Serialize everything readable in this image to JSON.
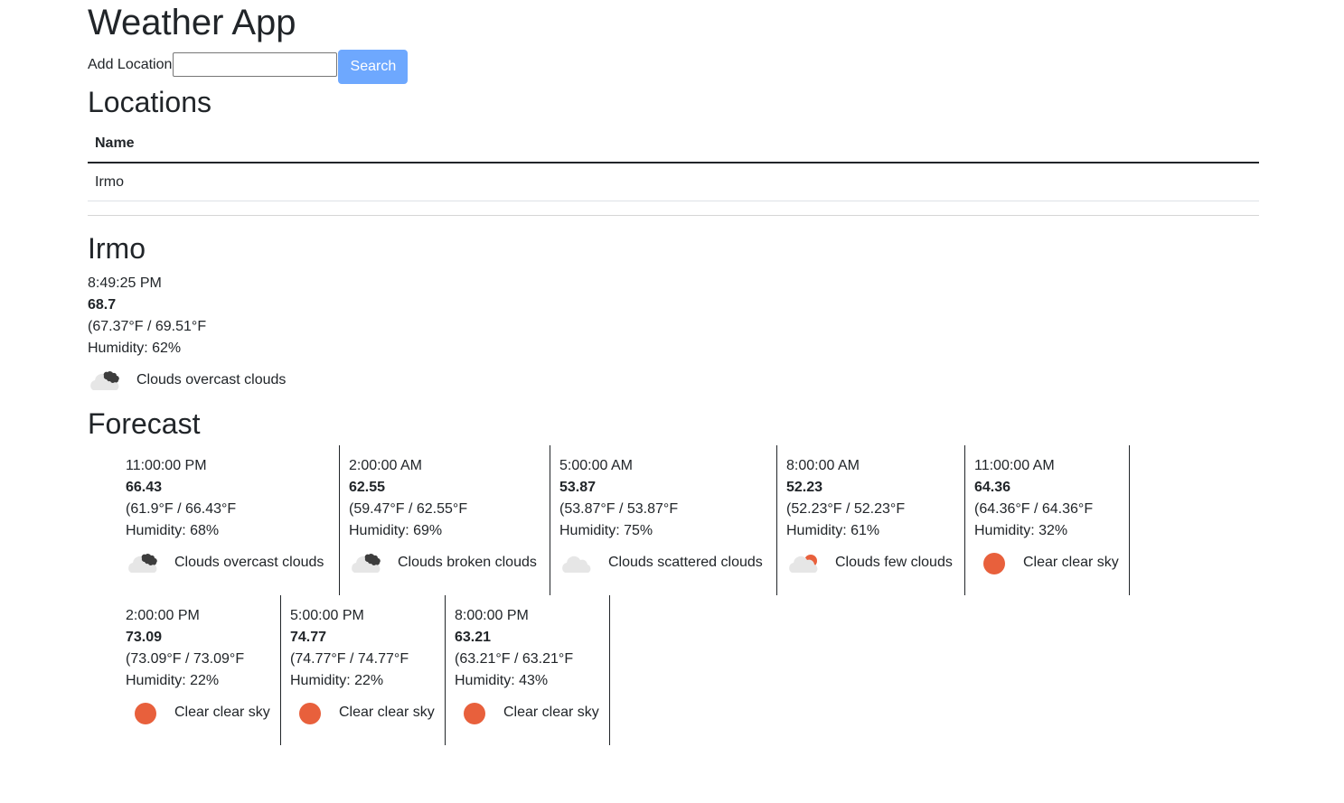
{
  "app": {
    "title": "Weather App"
  },
  "add_location": {
    "label": "Add Location",
    "input_value": "",
    "input_placeholder": "",
    "search_label": "Search"
  },
  "locations": {
    "title": "Locations",
    "columns": [
      "Name"
    ],
    "rows": [
      "Irmo"
    ]
  },
  "current": {
    "city": "Irmo",
    "time": "8:49:25 PM",
    "temp": "68.7",
    "range": "(67.37°F / 69.51°F",
    "humidity": "Humidity: 62%",
    "condition": "Clouds overcast clouds",
    "icon": "overcast-clouds-icon"
  },
  "forecast": {
    "title": "Forecast",
    "items": [
      {
        "time": "11:00:00 PM",
        "temp": "66.43",
        "range": "(61.9°F / 66.43°F",
        "humidity": "Humidity: 68%",
        "condition": "Clouds overcast clouds",
        "icon": "overcast-clouds-icon"
      },
      {
        "time": "2:00:00 AM",
        "temp": "62.55",
        "range": "(59.47°F / 62.55°F",
        "humidity": "Humidity: 69%",
        "condition": "Clouds broken clouds",
        "icon": "broken-clouds-icon"
      },
      {
        "time": "5:00:00 AM",
        "temp": "53.87",
        "range": "(53.87°F / 53.87°F",
        "humidity": "Humidity: 75%",
        "condition": "Clouds scattered clouds",
        "icon": "scattered-clouds-icon"
      },
      {
        "time": "8:00:00 AM",
        "temp": "52.23",
        "range": "(52.23°F / 52.23°F",
        "humidity": "Humidity: 61%",
        "condition": "Clouds few clouds",
        "icon": "few-clouds-icon"
      },
      {
        "time": "11:00:00 AM",
        "temp": "64.36",
        "range": "(64.36°F / 64.36°F",
        "humidity": "Humidity: 32%",
        "condition": "Clear clear sky",
        "icon": "clear-sky-icon"
      },
      {
        "time": "2:00:00 PM",
        "temp": "73.09",
        "range": "(73.09°F / 73.09°F",
        "humidity": "Humidity: 22%",
        "condition": "Clear clear sky",
        "icon": "clear-sky-icon"
      },
      {
        "time": "5:00:00 PM",
        "temp": "74.77",
        "range": "(74.77°F / 74.77°F",
        "humidity": "Humidity: 22%",
        "condition": "Clear clear sky",
        "icon": "clear-sky-icon"
      },
      {
        "time": "8:00:00 PM",
        "temp": "63.21",
        "range": "(63.21°F / 63.21°F",
        "humidity": "Humidity: 43%",
        "condition": "Clear clear sky",
        "icon": "clear-sky-icon"
      }
    ]
  },
  "colors": {
    "sun": "#e8603c",
    "cloud_light": "#e6e6e6",
    "cloud_dark": "#3d3d3d",
    "button": "#6ea8fe",
    "text": "#212529"
  }
}
